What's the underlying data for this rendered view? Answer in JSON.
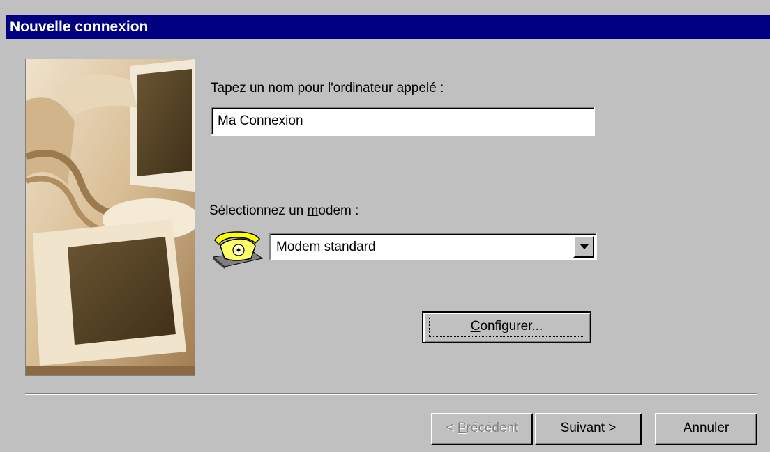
{
  "window": {
    "title": "Nouvelle connexion"
  },
  "name_field": {
    "label_mnemonic": "T",
    "label_rest": "apez un nom pour l'ordinateur appelé :",
    "value": "Ma Connexion"
  },
  "modem": {
    "label_before": "Sélectionnez un ",
    "label_mnemonic": "m",
    "label_after": "odem :",
    "selected": "Modem standard",
    "icon": "telephone-modem-icon"
  },
  "buttons": {
    "configure_mnemonic": "C",
    "configure_rest": "onfigurer...",
    "back_prefix": "< ",
    "back_mnemonic": "P",
    "back_rest": "récédent",
    "next": "Suivant >",
    "cancel": "Annuler"
  },
  "colors": {
    "titlebar": "#000080",
    "dialog": "#c0c0c0"
  }
}
